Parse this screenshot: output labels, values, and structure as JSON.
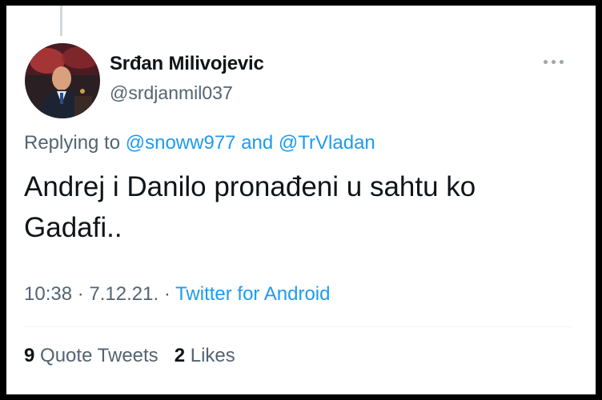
{
  "tweet": {
    "author": {
      "display_name": "Srđan Milivojevic",
      "handle": "@srdjanmil037",
      "avatar_icon": "profile-photo"
    },
    "more_icon": "more-dots-icon",
    "replying_prefix": "Replying to",
    "replying_to": [
      "@snoww977",
      "@TrVladan"
    ],
    "replying_joiner": "and",
    "text_lines": [
      "Andrej i Danilo pronađeni u sahtu ko",
      "Gadafi.."
    ],
    "time": "10:38",
    "separator": "·",
    "date": "7.12.21.",
    "source": "Twitter for Android",
    "stats": {
      "quote_tweets_count": "9",
      "quote_tweets_label": "Quote Tweets",
      "likes_count": "2",
      "likes_label": "Likes"
    }
  },
  "colors": {
    "accent": "#1d9bf0",
    "text": "#0f1419",
    "secondary": "#536471"
  }
}
